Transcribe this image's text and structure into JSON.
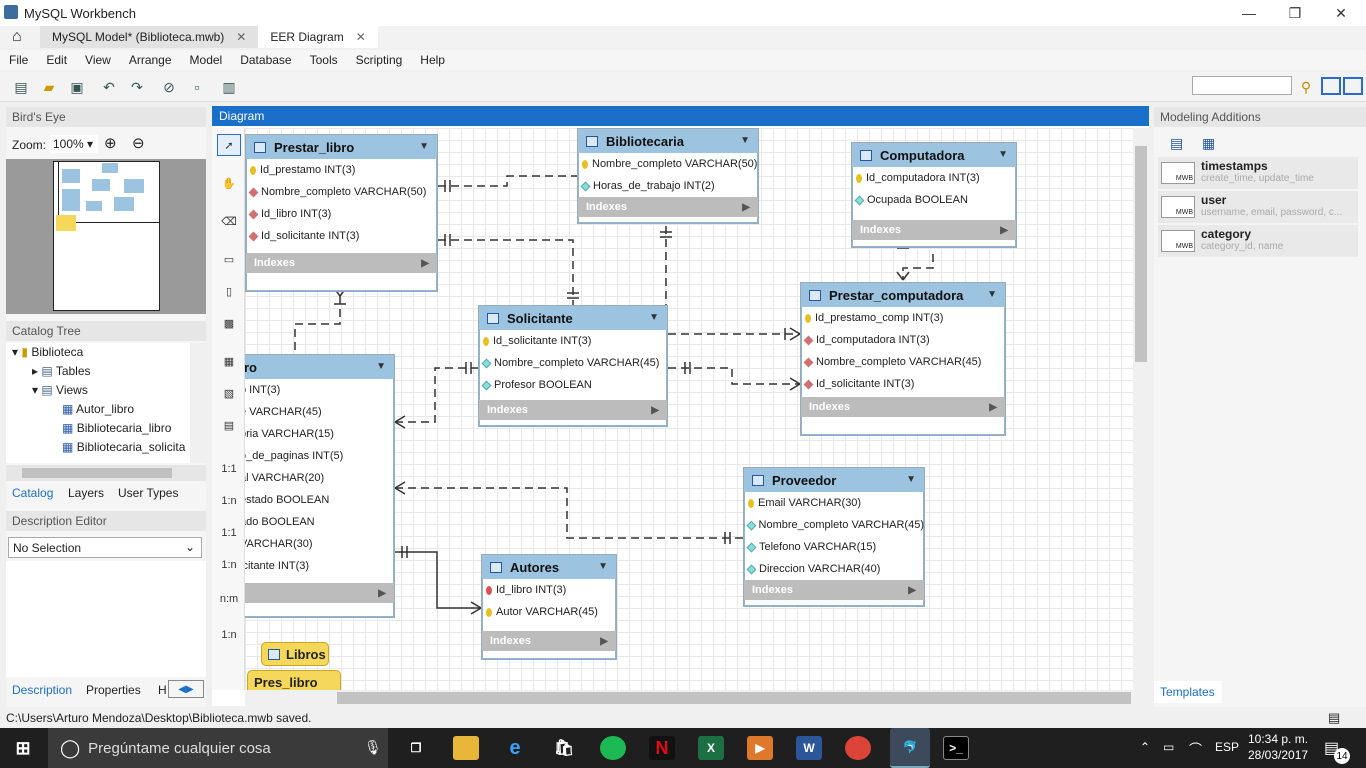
{
  "window": {
    "title": "MySQL Workbench"
  },
  "tabs": [
    {
      "label": "MySQL Model* (Biblioteca.mwb)"
    },
    {
      "label": "EER Diagram"
    }
  ],
  "menu": [
    "File",
    "Edit",
    "View",
    "Arrange",
    "Model",
    "Database",
    "Tools",
    "Scripting",
    "Help"
  ],
  "left": {
    "birds_eye": "Bird's Eye",
    "zoom_label": "Zoom:",
    "zoom_value": "100%",
    "catalog_tree": "Catalog Tree",
    "tree": [
      "Biblioteca",
      "Tables",
      "Views",
      "Autor_libro",
      "Bibliotecaria_libro",
      "Bibliotecaria_solicita"
    ],
    "tabs": [
      "Catalog",
      "Layers",
      "User Types"
    ],
    "desc_editor": "Description Editor",
    "selection": "No Selection",
    "bottom_tabs": [
      "Description",
      "Properties",
      "H"
    ]
  },
  "diagram": {
    "title": "Diagram",
    "tool_labels": [
      "1:1",
      "1:n",
      "1:1",
      "1:n",
      "n:m",
      "1:n"
    ],
    "tables": {
      "prestar_libro": {
        "name": "Prestar_libro",
        "cols": [
          "Id_prestamo INT(3)",
          "Nombre_completo VARCHAR(50)",
          "Id_libro INT(3)",
          "Id_solicitante INT(3)"
        ],
        "indexes": "Indexes"
      },
      "bibliotecaria": {
        "name": "Bibliotecaria",
        "cols": [
          "Nombre_completo VARCHAR(50)",
          "Horas_de_trabajo INT(2)"
        ],
        "indexes": "Indexes"
      },
      "computadora": {
        "name": "Computadora",
        "cols": [
          "Id_computadora INT(3)",
          "Ocupada BOOLEAN"
        ],
        "indexes": "Indexes"
      },
      "solicitante": {
        "name": "Solicitante",
        "cols": [
          "Id_solicitante INT(3)",
          "Nombre_completo VARCHAR(45)",
          "Profesor BOOLEAN"
        ],
        "indexes": "Indexes"
      },
      "prestar_computadora": {
        "name": "Prestar_computadora",
        "cols": [
          "Id_prestamo_comp INT(3)",
          "Id_computadora INT(3)",
          "Nombre_completo VARCHAR(45)",
          "Id_solicitante INT(3)"
        ],
        "indexes": "Indexes"
      },
      "libro": {
        "name": "ro",
        "cols": [
          "o INT(3)",
          "e VARCHAR(45)",
          "oria VARCHAR(15)",
          "o_de_paginas INT(5)",
          "al VARCHAR(20)",
          "estado BOOLEAN",
          "ado BOOLEAN",
          "VARCHAR(30)",
          "icitante INT(3)"
        ]
      },
      "proveedor": {
        "name": "Proveedor",
        "cols": [
          "Email VARCHAR(30)",
          "Nombre_completo VARCHAR(45)",
          "Telefono VARCHAR(15)",
          "Direccion VARCHAR(40)"
        ],
        "indexes": "Indexes"
      },
      "autores": {
        "name": "Autores",
        "cols": [
          "Id_libro INT(3)",
          "Autor VARCHAR(45)"
        ],
        "indexes": "Indexes"
      }
    },
    "notes": [
      "Libros",
      "Pres_libro"
    ]
  },
  "right": {
    "title": "Modeling Additions",
    "items": [
      {
        "name": "timestamps",
        "sub": "create_time, update_time"
      },
      {
        "name": "user",
        "sub": "username, email, password, c..."
      },
      {
        "name": "category",
        "sub": "category_id, name"
      }
    ],
    "mwb": "MWB",
    "tab": "Templates"
  },
  "status": "C:\\Users\\Arturo Mendoza\\Desktop\\Biblioteca.mwb saved.",
  "taskbar": {
    "search": "Pregúntame cualquier cosa",
    "lang": "ESP",
    "time": "10:34 p. m.",
    "date": "28/03/2017",
    "notif": "14"
  }
}
